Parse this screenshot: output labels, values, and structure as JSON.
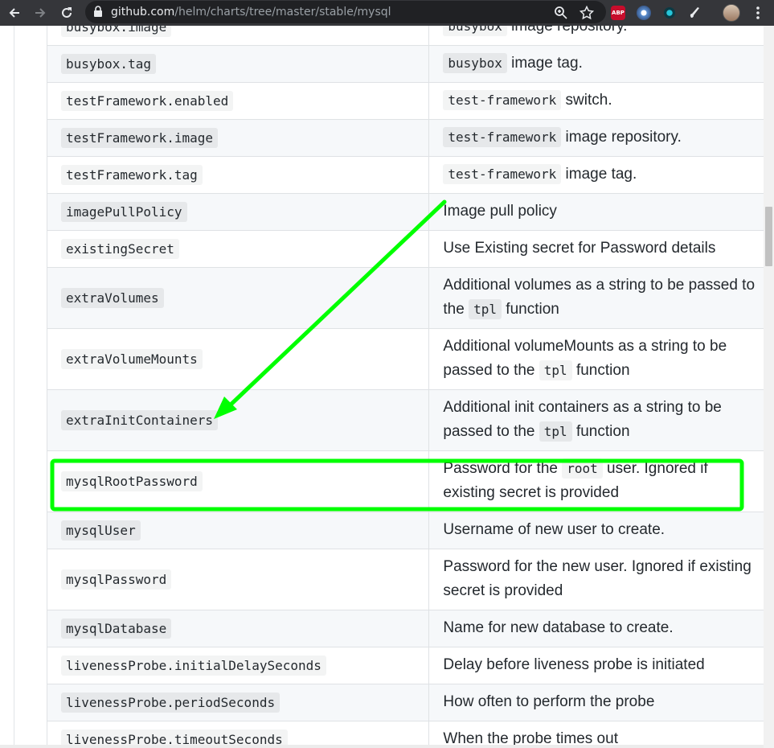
{
  "browser": {
    "url_host": "github.com",
    "url_path": "/helm/charts/tree/master/stable/mysql",
    "back_icon": "arrow-left-icon",
    "forward_icon": "arrow-right-icon",
    "reload_icon": "reload-icon",
    "extensions": {
      "abp_label": "ABP"
    },
    "colors": {
      "toolbar": "#35363a",
      "omnibox": "#202124"
    }
  },
  "annotation": {
    "color": "#00ff00",
    "arrow_from_row": "testFramework.tag",
    "arrow_to_row": "extraInitContainers",
    "highlight_row": "mysqlRootPassword"
  },
  "rows": [
    {
      "name": "busybox.image",
      "desc": [
        {
          "code": "busybox"
        },
        {
          "text": " image repository."
        }
      ]
    },
    {
      "name": "busybox.tag",
      "desc": [
        {
          "code": "busybox"
        },
        {
          "text": " image tag."
        }
      ]
    },
    {
      "name": "testFramework.enabled",
      "desc": [
        {
          "code": "test-framework"
        },
        {
          "text": " switch."
        }
      ]
    },
    {
      "name": "testFramework.image",
      "desc": [
        {
          "code": "test-framework"
        },
        {
          "text": " image repository."
        }
      ]
    },
    {
      "name": "testFramework.tag",
      "desc": [
        {
          "code": "test-framework"
        },
        {
          "text": " image tag."
        }
      ]
    },
    {
      "name": "imagePullPolicy",
      "desc": [
        {
          "text": "Image pull policy"
        }
      ]
    },
    {
      "name": "existingSecret",
      "desc": [
        {
          "text": "Use Existing secret for Password details"
        }
      ]
    },
    {
      "name": "extraVolumes",
      "desc": [
        {
          "text": "Additional volumes as a string to be passed to the "
        },
        {
          "code": "tpl"
        },
        {
          "text": " function"
        }
      ]
    },
    {
      "name": "extraVolumeMounts",
      "desc": [
        {
          "text": "Additional volumeMounts as a string to be passed to the "
        },
        {
          "code": "tpl"
        },
        {
          "text": " function"
        }
      ]
    },
    {
      "name": "extraInitContainers",
      "desc": [
        {
          "text": "Additional init containers as a string to be passed to the "
        },
        {
          "code": "tpl"
        },
        {
          "text": " function"
        }
      ]
    },
    {
      "name": "mysqlRootPassword",
      "desc": [
        {
          "text": "Password for the "
        },
        {
          "code": "root"
        },
        {
          "text": " user. Ignored if existing secret is provided"
        }
      ]
    },
    {
      "name": "mysqlUser",
      "desc": [
        {
          "text": "Username of new user to create."
        }
      ]
    },
    {
      "name": "mysqlPassword",
      "desc": [
        {
          "text": "Password for the new user. Ignored if existing secret is provided"
        }
      ]
    },
    {
      "name": "mysqlDatabase",
      "desc": [
        {
          "text": "Name for new database to create."
        }
      ]
    },
    {
      "name": "livenessProbe.initialDelaySeconds",
      "desc": [
        {
          "text": "Delay before liveness probe is initiated"
        }
      ]
    },
    {
      "name": "livenessProbe.periodSeconds",
      "desc": [
        {
          "text": "How often to perform the probe"
        }
      ]
    },
    {
      "name": "livenessProbe.timeoutSeconds",
      "desc": [
        {
          "text": "When the probe times out"
        }
      ]
    }
  ]
}
